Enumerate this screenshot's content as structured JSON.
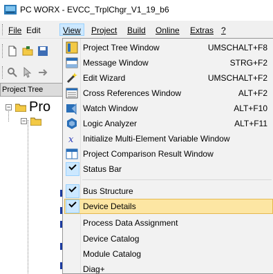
{
  "window": {
    "title": "PC WORX - EVCC_TrplChgr_V1_19_b6"
  },
  "menubar": {
    "items": [
      {
        "label": "File",
        "active": false
      },
      {
        "label": "Edit",
        "active": false
      },
      {
        "label": "View",
        "active": true
      },
      {
        "label": "Project",
        "active": false
      },
      {
        "label": "Build",
        "active": false
      },
      {
        "label": "Online",
        "active": false
      },
      {
        "label": "Extras",
        "active": false
      },
      {
        "label": "?",
        "active": false
      }
    ]
  },
  "left_panel": {
    "header": "Project Tree",
    "tree_root_label": "Pro"
  },
  "view_menu": {
    "items": [
      {
        "label": "Project Tree Window",
        "shortcut": "UMSCHALT+F8",
        "icon": "project-tree-icon"
      },
      {
        "label": "Message Window",
        "shortcut": "STRG+F2",
        "icon": "message-window-icon"
      },
      {
        "label": "Edit Wizard",
        "shortcut": "UMSCHALT+F2",
        "icon": "edit-wizard-icon"
      },
      {
        "label": "Cross References Window",
        "shortcut": "ALT+F2",
        "icon": "cross-references-icon"
      },
      {
        "label": "Watch Window",
        "shortcut": "ALT+F10",
        "icon": "watch-window-icon"
      },
      {
        "label": "Logic Analyzer",
        "shortcut": "ALT+F11",
        "icon": "logic-analyzer-icon"
      },
      {
        "label": "Initialize Multi-Element Variable Window",
        "shortcut": "",
        "icon": "initialize-variable-icon"
      },
      {
        "label": "Project Comparison Result Window",
        "shortcut": "",
        "icon": "project-comparison-icon"
      },
      {
        "label": "Status Bar",
        "shortcut": "",
        "icon": "checkmark-icon",
        "checked": true
      },
      {
        "label": "Bus Structure",
        "shortcut": "",
        "icon": "checkmark-icon",
        "checked": true
      },
      {
        "label": "Device Details",
        "shortcut": "",
        "icon": "checkmark-icon",
        "checked": true,
        "highlighted": true
      },
      {
        "label": "Process Data Assignment",
        "shortcut": ""
      },
      {
        "label": "Device Catalog",
        "shortcut": ""
      },
      {
        "label": "Module Catalog",
        "shortcut": ""
      },
      {
        "label": "Diag+",
        "shortcut": ""
      }
    ]
  },
  "colors": {
    "menu_highlight": "#fde6a3",
    "menu_highlight_border": "#e5b84e",
    "active_menu": "#cce8ff",
    "check_background": "#cce8ff"
  }
}
